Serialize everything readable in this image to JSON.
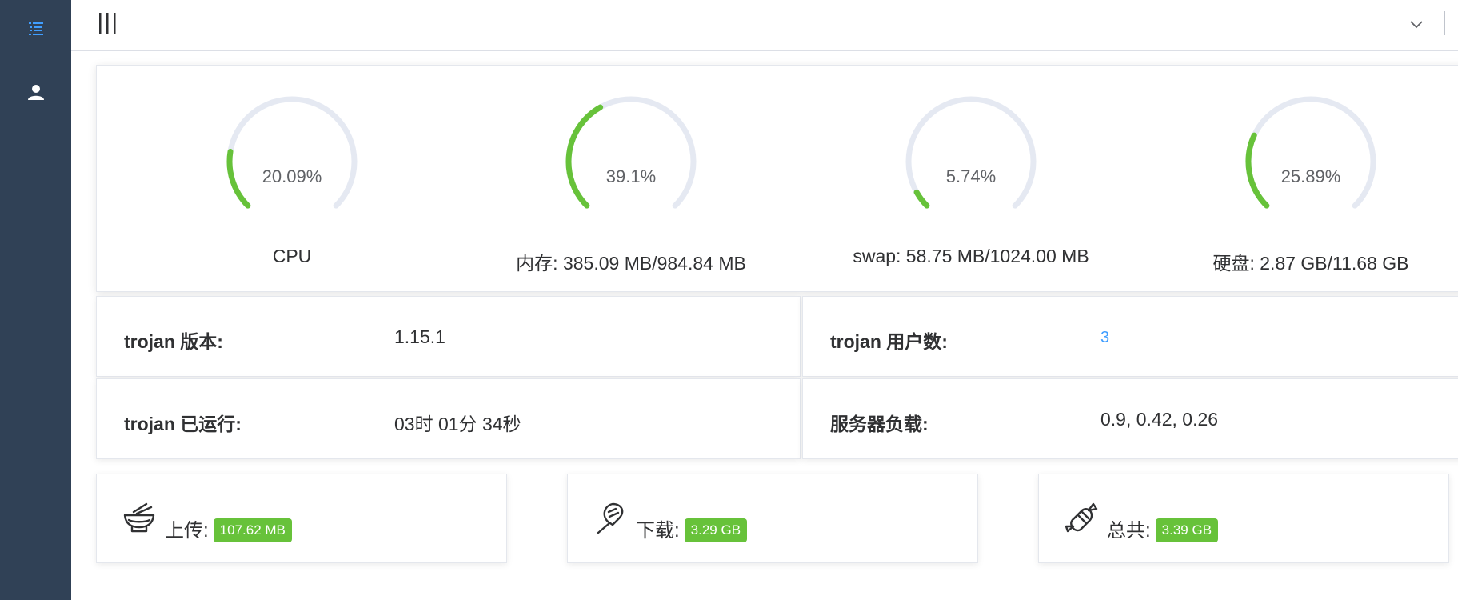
{
  "gauges": [
    {
      "percent_text": "20.09%",
      "value": 20.09,
      "label": "CPU"
    },
    {
      "percent_text": "39.1%",
      "value": 39.1,
      "label": "内存: 385.09 MB/984.84 MB"
    },
    {
      "percent_text": "5.74%",
      "value": 5.74,
      "label": "swap: 58.75 MB/1024.00 MB"
    },
    {
      "percent_text": "25.89%",
      "value": 25.89,
      "label": "硬盘: 2.87 GB/11.68 GB"
    }
  ],
  "info": {
    "version_key": "trojan 版本:",
    "version_val": "1.15.1",
    "users_key": "trojan 用户数:",
    "users_val": "3",
    "uptime_key": "trojan 已运行:",
    "uptime_val": "03时 01分 34秒",
    "load_key": "服务器负载:",
    "load_val": "0.9, 0.42, 0.26"
  },
  "traffic": {
    "upload_label": "上传:",
    "upload_val": "107.62 MB",
    "download_label": "下载:",
    "download_val": "3.29 GB",
    "total_label": "总共:",
    "total_val": "3.39 GB"
  },
  "colors": {
    "sidebar": "#304156",
    "gauge_fill": "#67c23a",
    "gauge_track": "#e5e9f2",
    "tag": "#67c23a",
    "link": "#409eff",
    "sidebar_icon_active": "#409eff"
  },
  "icons": {
    "sidebar_1": "list-menu-icon",
    "sidebar_2": "user-icon",
    "topbar_left": "hamburger-icon",
    "topbar_right": "chevron-down-icon",
    "upload": "bowl-icon",
    "download": "ice-cream-icon",
    "total": "candy-icon"
  }
}
